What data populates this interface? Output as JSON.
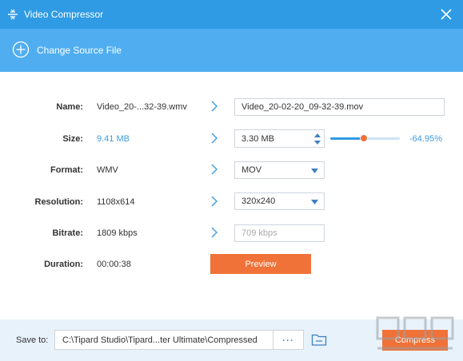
{
  "window": {
    "title": "Video Compressor"
  },
  "source": {
    "label": "Change Source File"
  },
  "rows": {
    "name": {
      "label": "Name:",
      "source_value": "Video_20-...32-39.wmv",
      "output_value": "Video_20-02-20_09-32-39.mov"
    },
    "size": {
      "label": "Size:",
      "source_value": "9.41 MB",
      "output_value": "3.30 MB",
      "slider_fraction": 0.48,
      "percent": "-64.95%"
    },
    "format": {
      "label": "Format:",
      "source_value": "WMV",
      "output_value": "MOV"
    },
    "resolution": {
      "label": "Resolution:",
      "source_value": "1108x614",
      "output_value": "320x240"
    },
    "bitrate": {
      "label": "Bitrate:",
      "source_value": "1809 kbps",
      "output_value": "709 kbps"
    },
    "duration": {
      "label": "Duration:",
      "source_value": "00:00:38"
    }
  },
  "preview": {
    "label": "Preview"
  },
  "footer": {
    "save_to_label": "Save to:",
    "path": "C:\\Tipard Studio\\Tipard...ter Ultimate\\Compressed",
    "browse_label": "···",
    "compress_label": "Compress"
  },
  "colors": {
    "titlebar": "#2f9be4",
    "sourcebar": "#50aef0",
    "accent_orange": "#f07238",
    "link_blue": "#3f9be0",
    "footer_bg": "#e8f2fb"
  },
  "icons": {
    "app": "compress-lines-icon",
    "close": "close-icon",
    "add": "plus-circle-icon",
    "arrow": "chevron-right-icon",
    "folder": "folder-icon"
  }
}
